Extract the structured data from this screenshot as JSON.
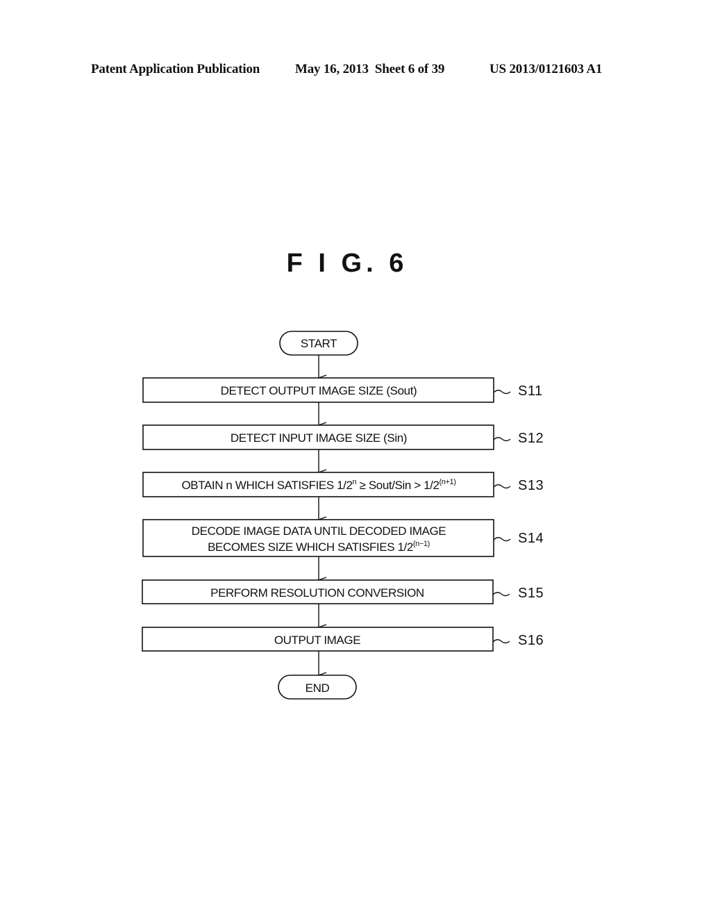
{
  "header": {
    "publication": "Patent Application Publication",
    "date_sheet": "May 16, 2013  Sheet 6 of 39",
    "number": "US 2013/0121603 A1"
  },
  "figure": {
    "title": "F I G. 6",
    "start": "START",
    "end": "END",
    "steps": [
      {
        "id": "S11",
        "lines": [
          {
            "text": "DETECT OUTPUT IMAGE SIZE (Sout)"
          }
        ]
      },
      {
        "id": "S12",
        "lines": [
          {
            "text": "DETECT INPUT IMAGE SIZE (Sin)"
          }
        ]
      },
      {
        "id": "S13",
        "lines": [
          {
            "text": "OBTAIN n WHICH SATISFIES 1/2",
            "sup1": "n",
            "mid": " ≥ Sout/Sin > 1/2",
            "sup2": "(n+1)"
          }
        ]
      },
      {
        "id": "S14",
        "lines": [
          {
            "text": "DECODE IMAGE DATA UNTIL DECODED IMAGE"
          },
          {
            "text": "BECOMES SIZE WHICH SATISFIES 1/2",
            "sup1": "(n−1)"
          }
        ]
      },
      {
        "id": "S15",
        "lines": [
          {
            "text": "PERFORM RESOLUTION CONVERSION"
          }
        ]
      },
      {
        "id": "S16",
        "lines": [
          {
            "text": "OUTPUT IMAGE"
          }
        ]
      }
    ]
  }
}
